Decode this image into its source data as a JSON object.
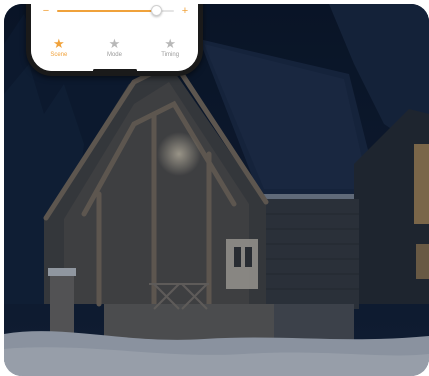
{
  "slider": {
    "minus_symbol": "−",
    "plus_symbol": "+",
    "level_fraction": 0.85
  },
  "tabs": [
    {
      "label": "Scene",
      "icon": "star-icon",
      "active": true
    },
    {
      "label": "Mode",
      "icon": "star-icon",
      "active": false
    },
    {
      "label": "Timing",
      "icon": "star-icon",
      "active": false
    }
  ],
  "colors": {
    "accent": "#f0a23b",
    "inactive": "#b8b8b8",
    "night_sky": "#0d1a2e"
  }
}
